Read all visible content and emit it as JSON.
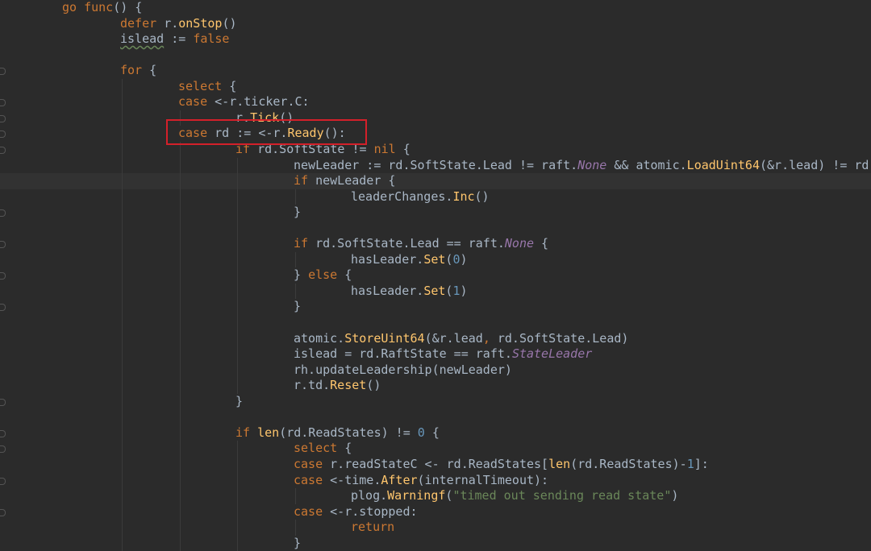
{
  "code_lines": [
    {
      "tokens": [
        {
          "t": "go ",
          "c": "kw"
        },
        {
          "t": "func",
          "c": "kw"
        },
        {
          "t": "() {",
          "c": ""
        }
      ]
    },
    {
      "tokens": [
        {
          "t": "defer ",
          "c": "kw"
        },
        {
          "t": "r.",
          "c": ""
        },
        {
          "t": "onStop",
          "c": "fn"
        },
        {
          "t": "()",
          "c": ""
        }
      ]
    },
    {
      "tokens": [
        {
          "t": "islead",
          "c": "und"
        },
        {
          "t": " := ",
          "c": ""
        },
        {
          "t": "false",
          "c": "kw"
        }
      ]
    },
    {
      "tokens": []
    },
    {
      "tokens": [
        {
          "t": "for ",
          "c": "kw"
        },
        {
          "t": "{",
          "c": ""
        }
      ]
    },
    {
      "tokens": [
        {
          "t": "select ",
          "c": "kw"
        },
        {
          "t": "{",
          "c": ""
        }
      ]
    },
    {
      "tokens": [
        {
          "t": "case ",
          "c": "kw"
        },
        {
          "t": "<-r.ticker.C:",
          "c": ""
        }
      ]
    },
    {
      "tokens": [
        {
          "t": "r.",
          "c": ""
        },
        {
          "t": "Tick",
          "c": "fn"
        },
        {
          "t": "()",
          "c": ""
        }
      ]
    },
    {
      "tokens": [
        {
          "t": "case ",
          "c": "kw"
        },
        {
          "t": "rd := <-r.",
          "c": ""
        },
        {
          "t": "Ready",
          "c": "fn"
        },
        {
          "t": "():",
          "c": ""
        }
      ]
    },
    {
      "tokens": [
        {
          "t": "if ",
          "c": "kw"
        },
        {
          "t": "rd.SoftState != ",
          "c": ""
        },
        {
          "t": "nil ",
          "c": "kw"
        },
        {
          "t": "{",
          "c": ""
        }
      ]
    },
    {
      "tokens": [
        {
          "t": "newLeader := rd.SoftState.Lead != raft.",
          "c": ""
        },
        {
          "t": "None",
          "c": "it"
        },
        {
          "t": " && atomic.",
          "c": ""
        },
        {
          "t": "LoadUint64",
          "c": "fn"
        },
        {
          "t": "(&r.lead) != rd.",
          "c": ""
        }
      ]
    },
    {
      "tokens": [
        {
          "t": "if ",
          "c": "kw"
        },
        {
          "t": "newLeader {",
          "c": ""
        }
      ]
    },
    {
      "tokens": [
        {
          "t": "leaderChanges.",
          "c": ""
        },
        {
          "t": "Inc",
          "c": "fn"
        },
        {
          "t": "()",
          "c": ""
        }
      ]
    },
    {
      "tokens": [
        {
          "t": "}",
          "c": ""
        }
      ]
    },
    {
      "tokens": []
    },
    {
      "tokens": [
        {
          "t": "if ",
          "c": "kw"
        },
        {
          "t": "rd.SoftState.Lead == raft.",
          "c": ""
        },
        {
          "t": "None",
          "c": "it"
        },
        {
          "t": " {",
          "c": ""
        }
      ]
    },
    {
      "tokens": [
        {
          "t": "hasLeader.",
          "c": ""
        },
        {
          "t": "Set",
          "c": "fn"
        },
        {
          "t": "(",
          "c": ""
        },
        {
          "t": "0",
          "c": "num"
        },
        {
          "t": ")",
          "c": ""
        }
      ]
    },
    {
      "tokens": [
        {
          "t": "} ",
          "c": ""
        },
        {
          "t": "else ",
          "c": "kw"
        },
        {
          "t": "{",
          "c": ""
        }
      ]
    },
    {
      "tokens": [
        {
          "t": "hasLeader.",
          "c": ""
        },
        {
          "t": "Set",
          "c": "fn"
        },
        {
          "t": "(",
          "c": ""
        },
        {
          "t": "1",
          "c": "num"
        },
        {
          "t": ")",
          "c": ""
        }
      ]
    },
    {
      "tokens": [
        {
          "t": "}",
          "c": ""
        }
      ]
    },
    {
      "tokens": []
    },
    {
      "tokens": [
        {
          "t": "atomic.",
          "c": ""
        },
        {
          "t": "StoreUint64",
          "c": "fn"
        },
        {
          "t": "(&r.lead",
          "c": ""
        },
        {
          "t": ", ",
          "c": "kw"
        },
        {
          "t": "rd.SoftState.Lead)",
          "c": ""
        }
      ]
    },
    {
      "tokens": [
        {
          "t": "islead = rd.RaftState == raft.",
          "c": ""
        },
        {
          "t": "StateLeader",
          "c": "it"
        }
      ]
    },
    {
      "tokens": [
        {
          "t": "rh.updateLeadership(newLeader)",
          "c": ""
        }
      ]
    },
    {
      "tokens": [
        {
          "t": "r.td.",
          "c": ""
        },
        {
          "t": "Reset",
          "c": "fn"
        },
        {
          "t": "()",
          "c": ""
        }
      ]
    },
    {
      "tokens": [
        {
          "t": "}",
          "c": ""
        }
      ]
    },
    {
      "tokens": []
    },
    {
      "tokens": [
        {
          "t": "if ",
          "c": "kw"
        },
        {
          "t": "len",
          "c": "fn"
        },
        {
          "t": "(rd.ReadStates) != ",
          "c": ""
        },
        {
          "t": "0",
          "c": "num"
        },
        {
          "t": " {",
          "c": ""
        }
      ]
    },
    {
      "tokens": [
        {
          "t": "select ",
          "c": "kw"
        },
        {
          "t": "{",
          "c": ""
        }
      ]
    },
    {
      "tokens": [
        {
          "t": "case ",
          "c": "kw"
        },
        {
          "t": "r.readStateC <- rd.ReadStates[",
          "c": ""
        },
        {
          "t": "len",
          "c": "fn"
        },
        {
          "t": "(rd.ReadStates)-",
          "c": ""
        },
        {
          "t": "1",
          "c": "num"
        },
        {
          "t": "]:",
          "c": ""
        }
      ]
    },
    {
      "tokens": [
        {
          "t": "case ",
          "c": "kw"
        },
        {
          "t": "<-time.",
          "c": ""
        },
        {
          "t": "After",
          "c": "fn"
        },
        {
          "t": "(internalTimeout):",
          "c": ""
        }
      ]
    },
    {
      "tokens": [
        {
          "t": "plog.",
          "c": ""
        },
        {
          "t": "Warningf",
          "c": "fn"
        },
        {
          "t": "(",
          "c": ""
        },
        {
          "t": "\"timed out sending read state\"",
          "c": "str"
        },
        {
          "t": ")",
          "c": ""
        }
      ]
    },
    {
      "tokens": [
        {
          "t": "case ",
          "c": "kw"
        },
        {
          "t": "<-r.stopped:",
          "c": ""
        }
      ]
    },
    {
      "tokens": [
        {
          "t": "return",
          "c": "kw"
        }
      ]
    },
    {
      "tokens": [
        {
          "t": "}",
          "c": ""
        }
      ]
    }
  ],
  "colors": {
    "background": "#2b2b2b",
    "keyword": "#cc7832",
    "function": "#ffc66d",
    "number": "#6897bb",
    "string": "#6a8759",
    "constant": "#9876aa",
    "text": "#a9b7c6",
    "highlight_box": "#d4202a"
  }
}
